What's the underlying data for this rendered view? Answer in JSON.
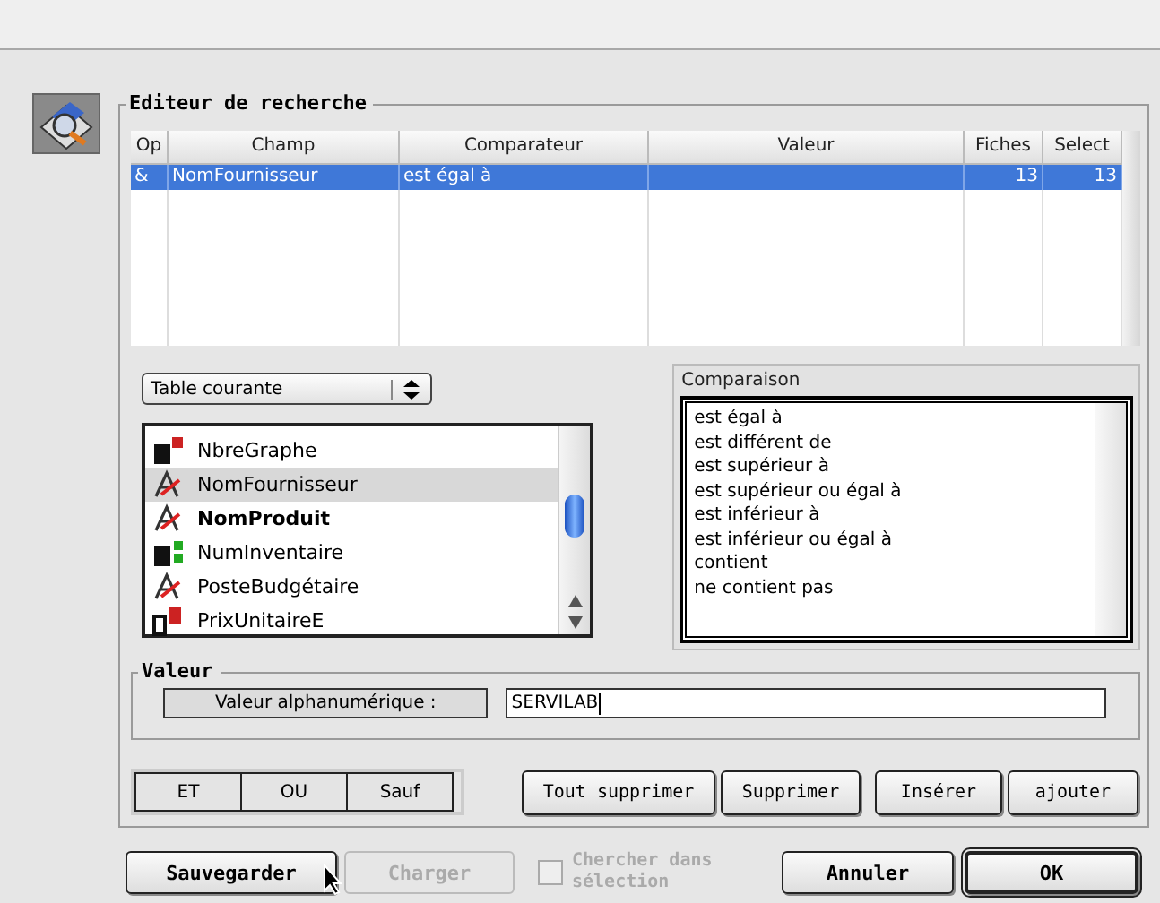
{
  "search_editor": {
    "title": "Editeur de recherche",
    "table": {
      "columns": [
        "Op",
        "Champ",
        "Comparateur",
        "Valeur",
        "Fiches",
        "Select"
      ],
      "rows": [
        {
          "cells": [
            "&",
            "NomFournisseur",
            "est égal à",
            "",
            "13",
            "13"
          ],
          "selected": true
        }
      ]
    }
  },
  "table_selector": {
    "value": "Table courante"
  },
  "fields": [
    {
      "name": "NbreGraphe",
      "kind": "long",
      "selected": false,
      "indexed": false
    },
    {
      "name": "NomFournisseur",
      "kind": "alpha",
      "selected": true,
      "indexed": false
    },
    {
      "name": "NomProduit",
      "kind": "alpha",
      "selected": false,
      "indexed": true
    },
    {
      "name": "NumInventaire",
      "kind": "integer",
      "selected": false,
      "indexed": false
    },
    {
      "name": "PosteBudgétaire",
      "kind": "alpha",
      "selected": false,
      "indexed": false
    },
    {
      "name": "PrixUnitaireE",
      "kind": "real",
      "selected": false,
      "indexed": false
    }
  ],
  "comparison": {
    "title": "Comparaison",
    "items": [
      {
        "label": "est égal à",
        "selected": false
      },
      {
        "label": "est différent de",
        "selected": false
      },
      {
        "label": "est supérieur à",
        "selected": false
      },
      {
        "label": "est supérieur ou égal à",
        "selected": false
      },
      {
        "label": "est inférieur à",
        "selected": false
      },
      {
        "label": "est inférieur ou égal à",
        "selected": false
      },
      {
        "label": "contient",
        "selected": false
      },
      {
        "label": "ne contient pas",
        "selected": false
      }
    ]
  },
  "value_group": {
    "title": "Valeur",
    "label": "Valeur alphanumérique :",
    "value": "SERVILAB"
  },
  "operators": [
    "ET",
    "OU",
    "Sauf"
  ],
  "actions": [
    "Tout supprimer",
    "Supprimer",
    "Insérer",
    "ajouter"
  ],
  "footer": {
    "buttons_left": [
      {
        "label": "Sauvegarder",
        "disabled": false
      },
      {
        "label": "Charger",
        "disabled": true
      }
    ],
    "checkbox": {
      "label": "Chercher dans sélection",
      "checked": false,
      "disabled": true
    },
    "buttons_right": [
      {
        "label": "Annuler",
        "default": false
      },
      {
        "label": "OK",
        "default": true
      }
    ]
  }
}
